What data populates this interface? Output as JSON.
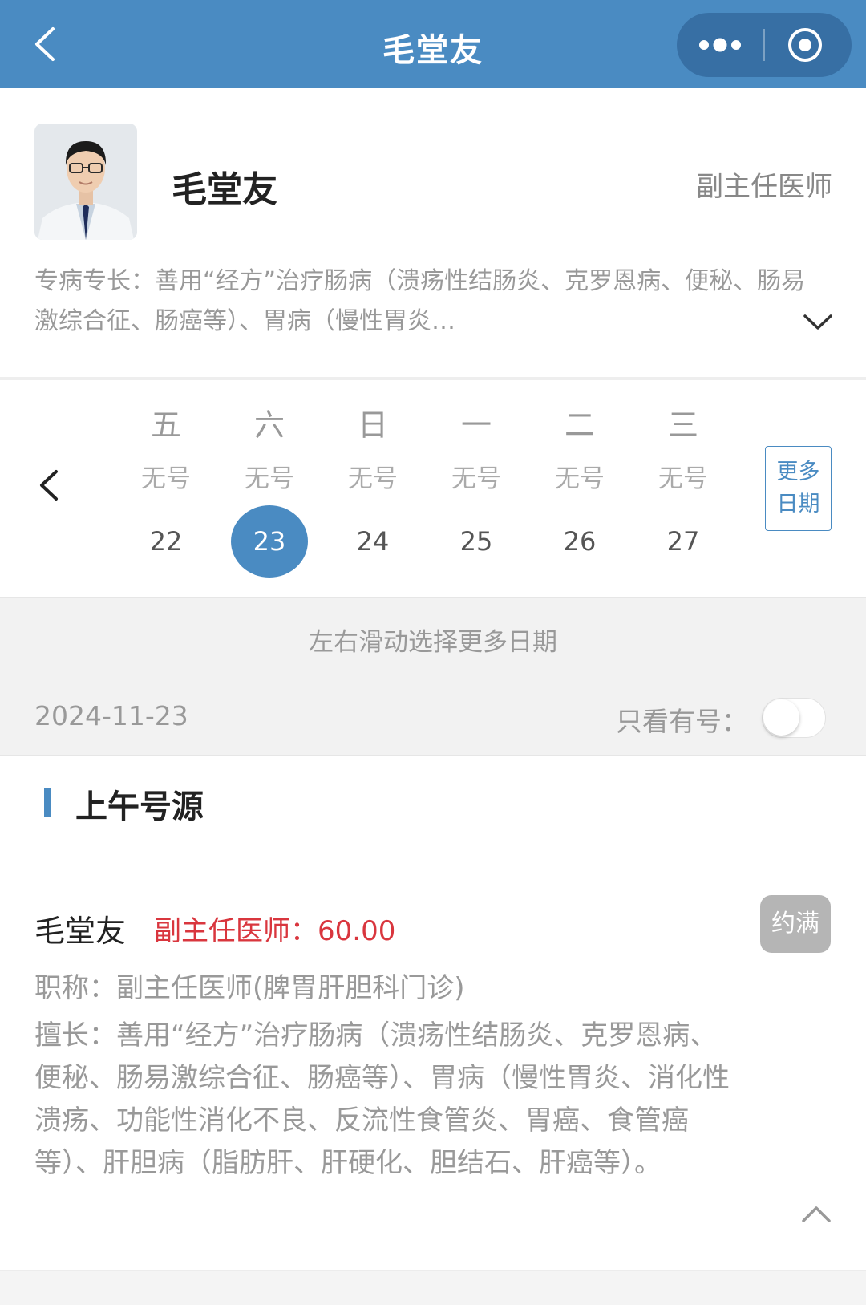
{
  "navbar": {
    "title": "毛堂友",
    "back_icon": "chevron-left-icon",
    "more_icon": "ellipsis-icon",
    "close_icon": "target-circle-icon",
    "color": "#4a8bc2"
  },
  "doctor": {
    "name": "毛堂友",
    "title": "副主任医师",
    "specialty": "专病专长：善用“经方”治疗肠病（溃疡性结肠炎、克罗恩病、便秘、肠易激综合征、肠癌等）、胃病（慢性胃炎…"
  },
  "dates": {
    "days": [
      {
        "week": "五",
        "status": "无号",
        "num": "22",
        "selected": false
      },
      {
        "week": "六",
        "status": "无号",
        "num": "23",
        "selected": true
      },
      {
        "week": "日",
        "status": "无号",
        "num": "24",
        "selected": false
      },
      {
        "week": "一",
        "status": "无号",
        "num": "25",
        "selected": false
      },
      {
        "week": "二",
        "status": "无号",
        "num": "26",
        "selected": false
      },
      {
        "week": "三",
        "status": "无号",
        "num": "27",
        "selected": false
      }
    ],
    "more_line1": "更多",
    "more_line2": "日期"
  },
  "filter": {
    "hint": "左右滑动选择更多日期",
    "current_date": "2024-11-23",
    "only_available_label": "只看有号：",
    "only_available_on": false
  },
  "morning": {
    "section_title": "上午号源",
    "slot": {
      "name": "毛堂友",
      "price": "副主任医师：60.00",
      "status": "约满",
      "zc": "职称：副主任医师(脾胃肝胆科门诊)",
      "desc": "擅长：善用“经方”治疗肠病（溃疡性结肠炎、克罗恩病、便秘、肠易激综合征、肠癌等）、胃病（慢性胃炎、消化性溃疡、功能性消化不良、反流性食管炎、胃癌、食管癌等）、肝胆病（脂肪肝、肝硬化、胆结石、肝癌等）。"
    }
  }
}
